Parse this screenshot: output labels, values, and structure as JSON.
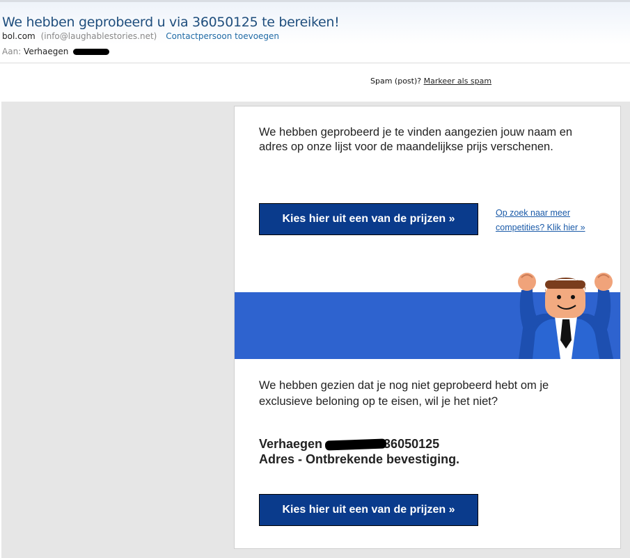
{
  "email": {
    "subject": "We hebben geprobeerd u via 36050125 te bereiken!",
    "sender_name": "bol.com",
    "sender_email": "(info@laughablestories.net)",
    "add_contact": "Contactpersoon toevoegen",
    "to_label": "Aan:",
    "to_name": "Verhaegen",
    "spam_prompt": "Spam (post)?",
    "spam_link": "Markeer als spam"
  },
  "body": {
    "intro": "We hebben geprobeerd je te vinden aangezien jouw naam en adres op onze lijst voor de maandelijkse prijs verschenen.",
    "cta_label": "Kies hier uit een van de prijzen »",
    "more_link": "Op zoek naar meer competities? Klik hier »",
    "second_para": "We hebben gezien dat je nog niet geprobeerd hebt om je exclusieve beloning op te eisen, wil je het niet?",
    "name_line_start": "Verhaegen",
    "name_line_end": "36050125",
    "address_line": "Adres - Ontbrekende bevestiging.",
    "cta_label_2": "Kies hier uit een van de prijzen »"
  },
  "colors": {
    "button_bg": "#0a3b8c",
    "banner_blue": "#2e63cf",
    "subject_blue": "#1f4e7d",
    "link_blue": "#1a5aa8"
  }
}
